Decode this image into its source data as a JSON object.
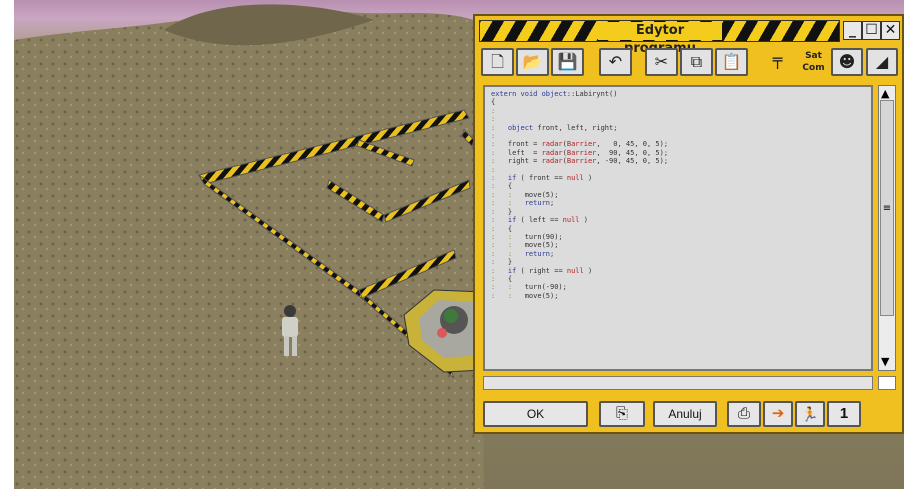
{
  "window": {
    "title": "Edytor programu",
    "controls": {
      "minimize": "_",
      "maximize": "☐",
      "close": "✕"
    }
  },
  "toolbar": {
    "items": [
      {
        "icon": "new-file-icon",
        "glyph": "🗋"
      },
      {
        "icon": "open-folder-icon",
        "glyph": "📂"
      },
      {
        "icon": "save-disk-icon",
        "glyph": "💾"
      },
      {
        "icon": "undo-icon",
        "glyph": "↶"
      },
      {
        "icon": "cut-scissors-icon",
        "glyph": "✂"
      },
      {
        "icon": "copy-icon",
        "glyph": "⧉"
      },
      {
        "icon": "paste-icon",
        "glyph": "📋"
      },
      {
        "icon": "tool-signpost-icon",
        "glyph": "╤"
      },
      {
        "icon": "satcom-icon",
        "glyph": "Sat Com"
      },
      {
        "icon": "soldier-icon",
        "glyph": "☻"
      },
      {
        "icon": "tank-icon",
        "glyph": "◢"
      }
    ]
  },
  "code": {
    "lines": [
      "extern void object::Labirynt()",
      "{",
      ":",
      ":",
      ":   object front, left, right;",
      ":",
      ":   front = radar(Barrier,   0, 45, 0, 5);",
      ":   left  = radar(Barrier,  90, 45, 0, 5);",
      ":   right = radar(Barrier, -90, 45, 0, 5);",
      ":",
      ":   if ( front == null )",
      ":   {",
      ":   :   move(5);",
      ":   :   return;",
      ":   }",
      ":   if ( left == null )",
      ":   {",
      ":   :   turn(90);",
      ":   :   move(5);",
      ":   :   return;",
      ":   }",
      ":   if ( right == null )",
      ":   {",
      ":   :   turn(-90);",
      ":   :   move(5);"
    ]
  },
  "buttons": {
    "ok": "OK",
    "clipboard": "⎘",
    "cancel": "Anuluj",
    "compile": "⎙",
    "run": "➔",
    "step": "🏃",
    "program_number": "1"
  },
  "colors": {
    "window": "#f0c020",
    "code_background": "#dcdcdc",
    "keyword": "#2a3a9a",
    "string_red": "#b02020",
    "bracket_guide": "#7b8a20"
  }
}
